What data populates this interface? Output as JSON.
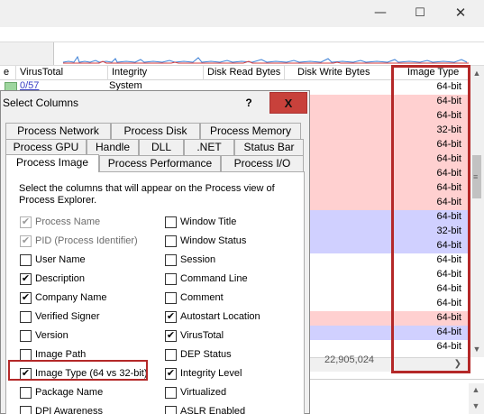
{
  "main_window": {
    "controls": {
      "minimize": "—",
      "maximize": "☐",
      "close": "✕"
    },
    "columns": {
      "col0": "e",
      "virustotal": "VirusTotal",
      "integrity": "Integrity",
      "disk_read": "Disk Read Bytes",
      "disk_write": "Disk Write Bytes",
      "image_type": "Image Type"
    },
    "first_row": {
      "virustotal": "0/57",
      "integrity": "System"
    },
    "image_types": [
      "64-bit",
      "64-bit",
      "64-bit",
      "32-bit",
      "64-bit",
      "64-bit",
      "64-bit",
      "64-bit",
      "64-bit",
      "64-bit",
      "32-bit",
      "64-bit",
      "64-bit",
      "64-bit",
      "64-bit",
      "64-bit",
      "64-bit",
      "64-bit",
      "64-bit"
    ],
    "row_colors": [
      "#ffffff",
      "#ffd0d0",
      "#ffd0d0",
      "#ffd0d0",
      "#ffd0d0",
      "#ffd0d0",
      "#ffd0d0",
      "#ffd0d0",
      "#ffd0d0",
      "#d0d0ff",
      "#d0d0ff",
      "#d0d0ff",
      "#ffffff",
      "#ffffff",
      "#ffffff",
      "#ffffff",
      "#ffd0d0",
      "#d0d0ff",
      "#ffffff"
    ],
    "hscroll_value": "22,905,024",
    "colors": {
      "highlight_border": "#b42828",
      "service_row": "#ffd0d0",
      "own_process_row": "#d0d0ff"
    }
  },
  "dialog": {
    "title": "Select Columns",
    "help_button": "?",
    "close_button": "X",
    "tabs_row1": [
      "Process Network",
      "Process Disk",
      "Process Memory"
    ],
    "tabs_row2": [
      "Process GPU",
      "Handle",
      "DLL",
      ".NET",
      "Status Bar"
    ],
    "tabs_row3": [
      "Process Image",
      "Process Performance",
      "Process I/O"
    ],
    "selected_tab": "Process Image",
    "instructions": "Select the columns that will appear on the Process view of Process Explorer.",
    "left_options": [
      {
        "label": "Process Name",
        "checked": true,
        "disabled": true
      },
      {
        "label": "PID (Process Identifier)",
        "checked": true,
        "disabled": true
      },
      {
        "label": "User Name",
        "checked": false,
        "disabled": false
      },
      {
        "label": "Description",
        "checked": true,
        "disabled": false
      },
      {
        "label": "Company Name",
        "checked": true,
        "disabled": false
      },
      {
        "label": "Verified Signer",
        "checked": false,
        "disabled": false
      },
      {
        "label": "Version",
        "checked": false,
        "disabled": false
      },
      {
        "label": "Image Path",
        "checked": false,
        "disabled": false
      },
      {
        "label": "Image Type (64 vs 32-bit)",
        "checked": true,
        "disabled": false
      },
      {
        "label": "Package Name",
        "checked": false,
        "disabled": false
      },
      {
        "label": "DPI Awareness",
        "checked": false,
        "disabled": false
      }
    ],
    "right_options": [
      {
        "label": "Window Title",
        "checked": false
      },
      {
        "label": "Window Status",
        "checked": false
      },
      {
        "label": "Session",
        "checked": false
      },
      {
        "label": "Command Line",
        "checked": false
      },
      {
        "label": "Comment",
        "checked": false
      },
      {
        "label": "Autostart Location",
        "checked": true
      },
      {
        "label": "VirusTotal",
        "checked": true
      },
      {
        "label": "DEP Status",
        "checked": false
      },
      {
        "label": "Integrity Level",
        "checked": true
      },
      {
        "label": "Virtualized",
        "checked": false
      },
      {
        "label": "ASLR Enabled",
        "checked": false
      }
    ]
  }
}
